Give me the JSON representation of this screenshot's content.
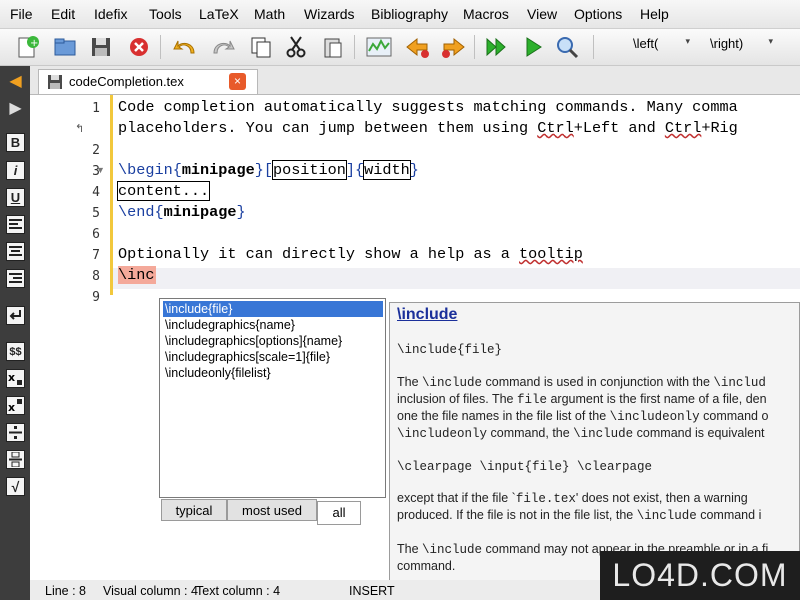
{
  "menu": {
    "items": [
      "File",
      "Edit",
      "Idefix",
      "Tools",
      "LaTeX",
      "Math",
      "Wizards",
      "Bibliography",
      "Macros",
      "View",
      "Options",
      "Help"
    ]
  },
  "toolbar": {
    "left_combo": "\\left(",
    "right_combo": "\\right)",
    "icons": [
      "new-file-icon",
      "open-file-icon",
      "save-icon",
      "close-file-icon",
      "undo-icon",
      "redo-icon",
      "copy-icon",
      "cut-icon",
      "paste-icon",
      "structure-icon",
      "previous-mark-icon",
      "next-mark-icon",
      "compile-icon",
      "run-icon",
      "view-icon"
    ]
  },
  "left_toolbar": {
    "icons": [
      "arrow-left-icon",
      "arrow-right-icon",
      "bold-icon",
      "italic-icon",
      "underline-icon",
      "align-left-icon",
      "align-center-icon",
      "align-right-icon",
      "newline-icon",
      "math-mode-icon",
      "subscript-icon",
      "superscript-icon",
      "fraction-icon",
      "dfrac-icon",
      "sqrt-icon"
    ],
    "labels": {
      "bold": "B",
      "italic": "i",
      "underline": "U",
      "math": "$$",
      "sqrt": "√"
    }
  },
  "tab": {
    "filename": "codeCompletion.tex",
    "close": "×"
  },
  "editor": {
    "line_numbers": [
      "1",
      "2",
      "3",
      "4",
      "5",
      "6",
      "7",
      "8",
      "9"
    ],
    "line1": "Code completion automatically suggests matching commands. Many comma",
    "line1b_pre": "placeholders. You can jump between them using ",
    "line1b_key1": "Ctrl",
    "line1b_mid": "+Left and ",
    "line1b_key2": "Ctrl",
    "line1b_end": "+Rig",
    "line3_begin": "\\begin",
    "line3_brace1": "{",
    "line3_env": "minipage",
    "line3_brace2": "}[",
    "line3_pos": "position",
    "line3_brace3": "]{",
    "line3_width": "width",
    "line3_brace4": "}",
    "line4": "content...",
    "line5_end": "\\end",
    "line5_brace1": "{",
    "line5_env": "minipage",
    "line5_brace2": "}",
    "line7_pre": "Optionally it can directly show a help as a ",
    "line7_word": "tooltip",
    "line8": "\\inc"
  },
  "completer": {
    "items": [
      "\\include{file}",
      "\\includegraphics{name}",
      "\\includegraphics[options]{name}",
      "\\includegraphics[scale=1]{file}",
      "\\includeonly{filelist}"
    ],
    "selected_index": 0,
    "tabs": [
      "typical",
      "most used",
      "all"
    ],
    "active_tab": "all"
  },
  "help": {
    "title": "\\include",
    "syntax": "\\include{file}",
    "p1_a": "The ",
    "p1_code1": "\\include",
    "p1_b": " command is used in conjunction with the ",
    "p1_code2": "\\includ",
    "p2": "inclusion of files. The ",
    "p2_code": "file",
    "p2_b": " argument is the first name of a file, den",
    "p3_a": "one the file names in the file list of the ",
    "p3_code": "\\includeonly",
    "p3_b": " command o",
    "p4_code1": "\\includeonly",
    "p4_a": " command, the ",
    "p4_code2": "\\include",
    "p4_b": " command is equivalent",
    "example": "\\clearpage \\input{file} \\clearpage",
    "p5_a": "except that if the file `",
    "p5_code": "file.tex",
    "p5_b": "' does not exist, then a warning",
    "p6_a": "produced. If the file is not in the file list, the ",
    "p6_code": "\\include",
    "p6_b": " command i",
    "p7_a": "The ",
    "p7_code": "\\include",
    "p7_b": " command may not appear in the preamble or in a fi",
    "p8": "command."
  },
  "status": {
    "line": "Line : 8",
    "visual_column": "Visual column : 4",
    "text_column": "Text column : 4",
    "mode": "INSERT"
  },
  "watermark": "LO4D.COM",
  "colors": {
    "keyword_blue": "#1a3fa0",
    "selection_blue": "#3876d6",
    "fold_yellow": "#f2c83c",
    "line8_highlight": "#f4a99a",
    "close_orange": "#e85a2a"
  }
}
